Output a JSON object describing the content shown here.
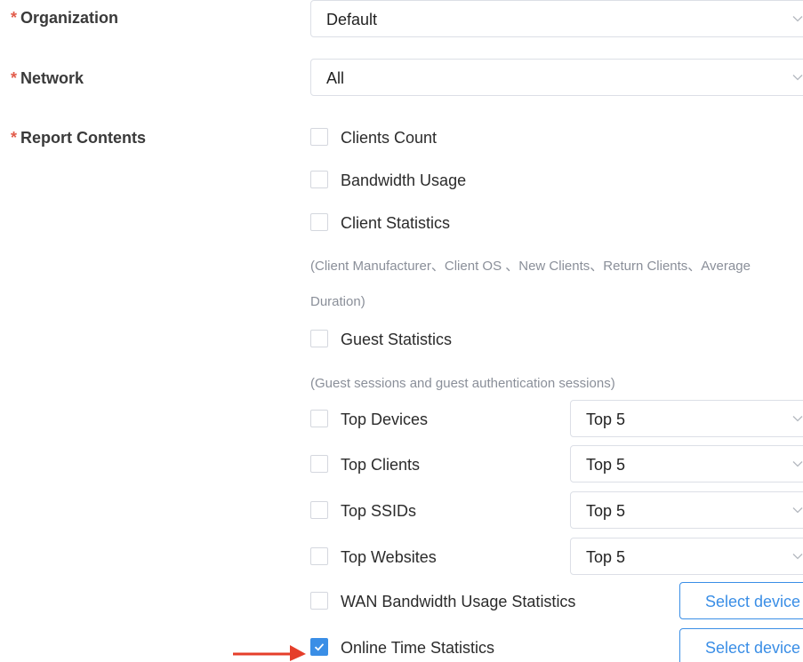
{
  "form": {
    "required_mark": "*",
    "organization": {
      "label": "Organization",
      "value": "Default"
    },
    "network": {
      "label": "Network",
      "value": "All"
    },
    "report_contents": {
      "label": "Report Contents",
      "items": [
        {
          "label": "Clients Count",
          "checked": false
        },
        {
          "label": "Bandwidth Usage",
          "checked": false
        },
        {
          "label": "Client Statistics",
          "checked": false
        },
        {
          "label": "Guest Statistics",
          "checked": false
        },
        {
          "label": "Top Devices",
          "checked": false,
          "select": "Top 5"
        },
        {
          "label": "Top Clients",
          "checked": false,
          "select": "Top 5"
        },
        {
          "label": "Top SSIDs",
          "checked": false,
          "select": "Top 5"
        },
        {
          "label": "Top Websites",
          "checked": false,
          "select": "Top 5"
        },
        {
          "label": "WAN Bandwidth Usage Statistics",
          "checked": false,
          "button": "Select device"
        },
        {
          "label": "Online Time Statistics",
          "checked": true,
          "button": "Select device"
        }
      ],
      "client_statistics_note_line1": "(Client Manufacturer、Client OS 、New Clients、Return Clients、Average",
      "client_statistics_note_line2": "Duration)",
      "guest_statistics_note": "(Guest sessions and guest authentication sessions)"
    }
  },
  "colors": {
    "accent": "#3a8ee6",
    "required": "#e25c4b",
    "arrow": "#e53e2a"
  },
  "icons": {
    "dropdown": "chevron-down-icon",
    "check": "check-icon",
    "annotation": "arrow-right-icon"
  }
}
